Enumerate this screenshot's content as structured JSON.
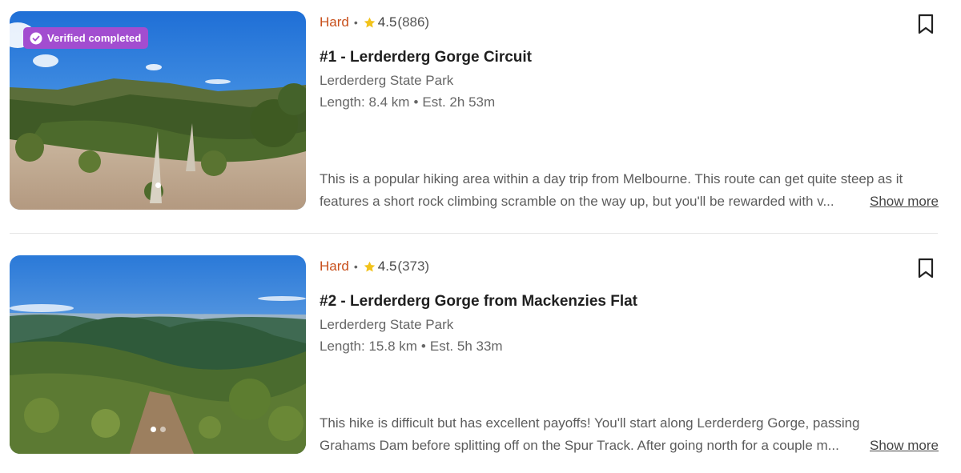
{
  "trails": [
    {
      "badge": "Verified completed",
      "difficulty": "Hard",
      "rating": "4.5",
      "review_count": "(886)",
      "title": "#1 - Lerderderg Gorge Circuit",
      "park": "Lerderderg State Park",
      "length": "Length: 8.4 km",
      "est_time": "Est. 2h 53m",
      "desc_line1": "This is a popular hiking area within a day trip from Melbourne. This route can get quite steep as it",
      "desc_line2": "features a short rock climbing scramble on the way up, but you'll be rewarded with v...",
      "show_more": "Show more"
    },
    {
      "difficulty": "Hard",
      "rating": "4.5",
      "review_count": "(373)",
      "title": "#2 - Lerderderg Gorge from Mackenzies Flat",
      "park": "Lerderderg State Park",
      "length": "Length: 15.8 km",
      "est_time": "Est. 5h 33m",
      "desc_line1": "This hike is difficult but has excellent payoffs! You'll start along Lerderderg Gorge, passing",
      "desc_line2": "Grahams Dam before splitting off on the Spur Track. After going north for a couple m...",
      "show_more": "Show more"
    }
  ],
  "icons": {
    "star": "star-icon",
    "bookmark": "bookmark-icon",
    "check": "check-circle-icon"
  },
  "colors": {
    "difficulty_hard": "#c8501c",
    "badge_bg": "#a24dd0",
    "star": "#f2c31b"
  }
}
